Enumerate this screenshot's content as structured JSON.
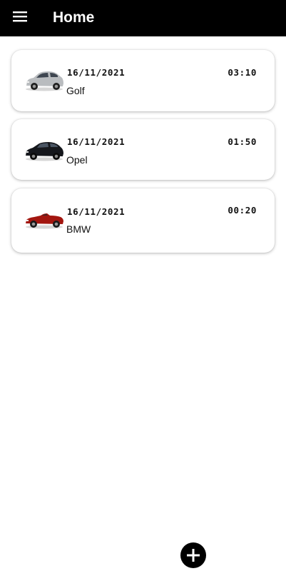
{
  "appbar": {
    "title": "Home",
    "menu_icon": "menu-icon"
  },
  "entries": [
    {
      "date": "16/11/2021",
      "time": "03:10",
      "name": "Golf",
      "car_color": "#b9bcbf"
    },
    {
      "date": "16/11/2021",
      "time": "01:50",
      "name": "Opel",
      "car_color": "#15171c"
    },
    {
      "date": "16/11/2021",
      "time": "00:20",
      "name": "BMW",
      "car_color": "#a3160f"
    }
  ],
  "fab": {
    "icon": "plus-icon",
    "color": "#000000"
  }
}
